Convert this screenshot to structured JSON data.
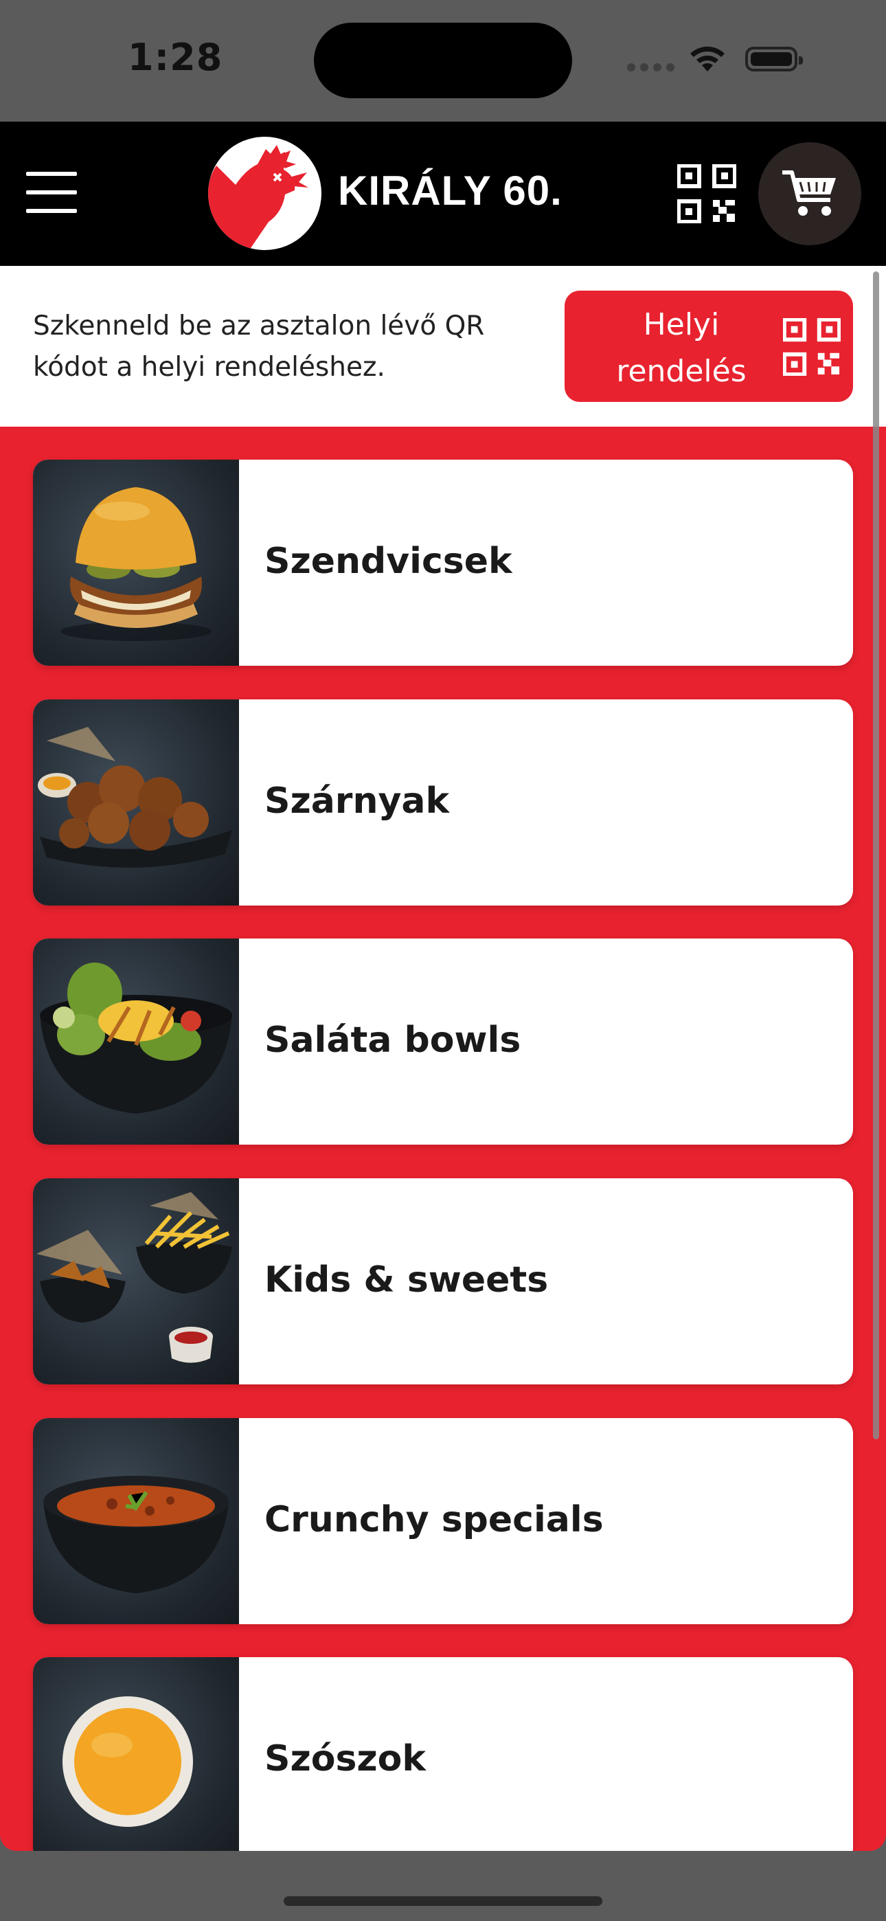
{
  "status_bar": {
    "time": "1:28"
  },
  "header": {
    "brand_name": "KIRÁLY 60.",
    "menu_icon": "hamburger-icon",
    "qr_icon": "qr-code-icon",
    "cart_icon": "shopping-cart-icon"
  },
  "banner": {
    "text": "Szkenneld be az asztalon lévő QR kódot a helyi rendeléshez.",
    "button_label": "Helyi rendelés"
  },
  "categories": [
    {
      "label": "Szendvicsek",
      "image": "sandwich-photo"
    },
    {
      "label": "Szárnyak",
      "image": "wings-photo"
    },
    {
      "label": "Saláta bowls",
      "image": "salad-photo"
    },
    {
      "label": "Kids & sweets",
      "image": "kids-fries-photo"
    },
    {
      "label": "Crunchy specials",
      "image": "stew-bowl-photo"
    },
    {
      "label": "Szószok",
      "image": "sauce-photo"
    }
  ],
  "colors": {
    "accent": "#e8222f",
    "header_bg": "#000000",
    "cart_bg": "#2b2422"
  }
}
